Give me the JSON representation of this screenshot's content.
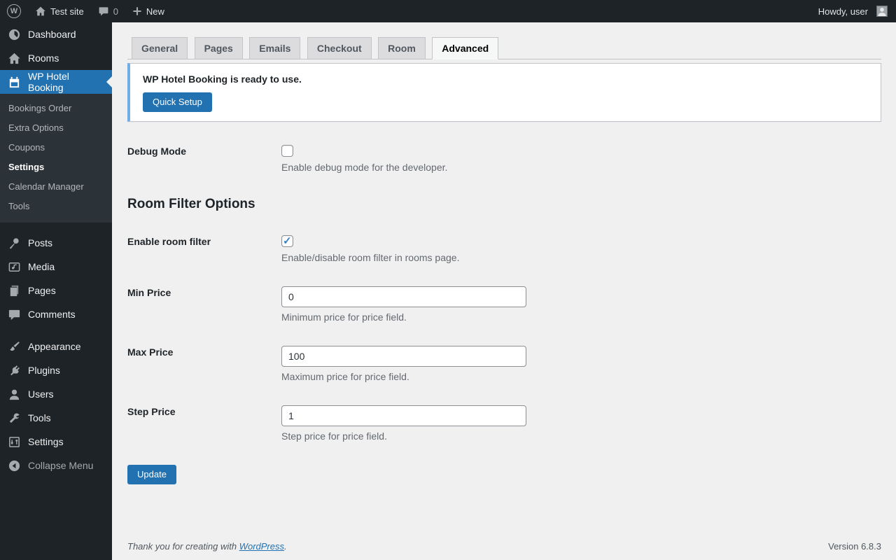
{
  "admin_bar": {
    "site_name": "Test site",
    "comments_count": "0",
    "new_label": "New",
    "howdy": "Howdy, user",
    "logo_letter": "W"
  },
  "sidebar": {
    "dashboard": {
      "label": "Dashboard",
      "icon": "dashboard-icon"
    },
    "rooms": {
      "label": "Rooms",
      "icon": "house-icon"
    },
    "hotel_booking": {
      "label": "WP Hotel Booking",
      "icon": "calendar-icon",
      "active": true
    },
    "hotel_submenu": {
      "items": [
        {
          "label": "Bookings Order"
        },
        {
          "label": "Extra Options"
        },
        {
          "label": "Coupons"
        },
        {
          "label": "Settings",
          "current": true
        },
        {
          "label": "Calendar Manager"
        },
        {
          "label": "Tools"
        }
      ]
    },
    "posts": {
      "label": "Posts",
      "icon": "pin-icon"
    },
    "media": {
      "label": "Media",
      "icon": "media-icon"
    },
    "pages": {
      "label": "Pages",
      "icon": "pages-icon"
    },
    "comments": {
      "label": "Comments",
      "icon": "comment-icon"
    },
    "appearance": {
      "label": "Appearance",
      "icon": "brush-icon"
    },
    "plugins": {
      "label": "Plugins",
      "icon": "plug-icon"
    },
    "users": {
      "label": "Users",
      "icon": "user-icon"
    },
    "tools": {
      "label": "Tools",
      "icon": "wrench-icon"
    },
    "settings": {
      "label": "Settings",
      "icon": "sliders-icon"
    },
    "collapse": {
      "label": "Collapse Menu",
      "icon": "collapse-icon"
    }
  },
  "tabs": {
    "items": [
      {
        "label": "General"
      },
      {
        "label": "Pages"
      },
      {
        "label": "Emails"
      },
      {
        "label": "Checkout"
      },
      {
        "label": "Room"
      },
      {
        "label": "Advanced",
        "active": true
      }
    ]
  },
  "notice": {
    "message": "WP Hotel Booking is ready to use.",
    "button_label": "Quick Setup"
  },
  "form": {
    "debug": {
      "label": "Debug Mode",
      "checked": false,
      "description": "Enable debug mode for the developer."
    },
    "section_heading": "Room Filter Options",
    "enable_filter": {
      "label": "Enable room filter",
      "checked": true,
      "description": "Enable/disable room filter in rooms page."
    },
    "min_price": {
      "label": "Min Price",
      "value": "0",
      "description": "Minimum price for price field."
    },
    "max_price": {
      "label": "Max Price",
      "value": "100",
      "description": "Maximum price for price field."
    },
    "step_price": {
      "label": "Step Price",
      "value": "1",
      "description": "Step price for price field."
    },
    "submit_label": "Update"
  },
  "footer": {
    "thanks_prefix": "Thank you for creating with ",
    "link_label": "WordPress",
    "suffix": ".",
    "version": "Version 6.8.3"
  },
  "colors": {
    "accent": "#2271b1",
    "adminbar_bg": "#1d2327",
    "submenu_bg": "#2c3338",
    "notice_border": "#72aee6",
    "body_bg": "#f0f0f1",
    "check_blue": "#3582c4"
  }
}
